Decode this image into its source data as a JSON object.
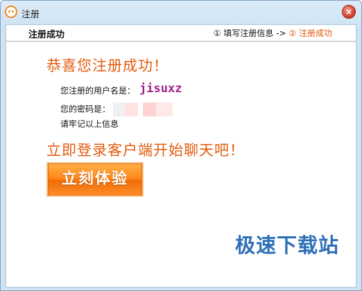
{
  "window": {
    "title": "注册",
    "close_label": "×"
  },
  "header": {
    "title": "注册成功",
    "step1": "① 填写注册信息",
    "arrow": "->",
    "step2": "② 注册成功"
  },
  "main": {
    "congrats": "恭喜您注册成功！",
    "username_label": "您注册的用户名是：",
    "username_value": "jisuxz",
    "password_label": "您的密码是：",
    "remember_text": "请牢记以上信息",
    "login_prompt": "立即登录客户端开始聊天吧！",
    "try_button_label": "立刻体验"
  },
  "watermark": "极速下载站",
  "colors": {
    "accent_orange": "#e45b0e",
    "username_purple": "#a0208c",
    "watermark_blue": "#2d6fb6"
  }
}
